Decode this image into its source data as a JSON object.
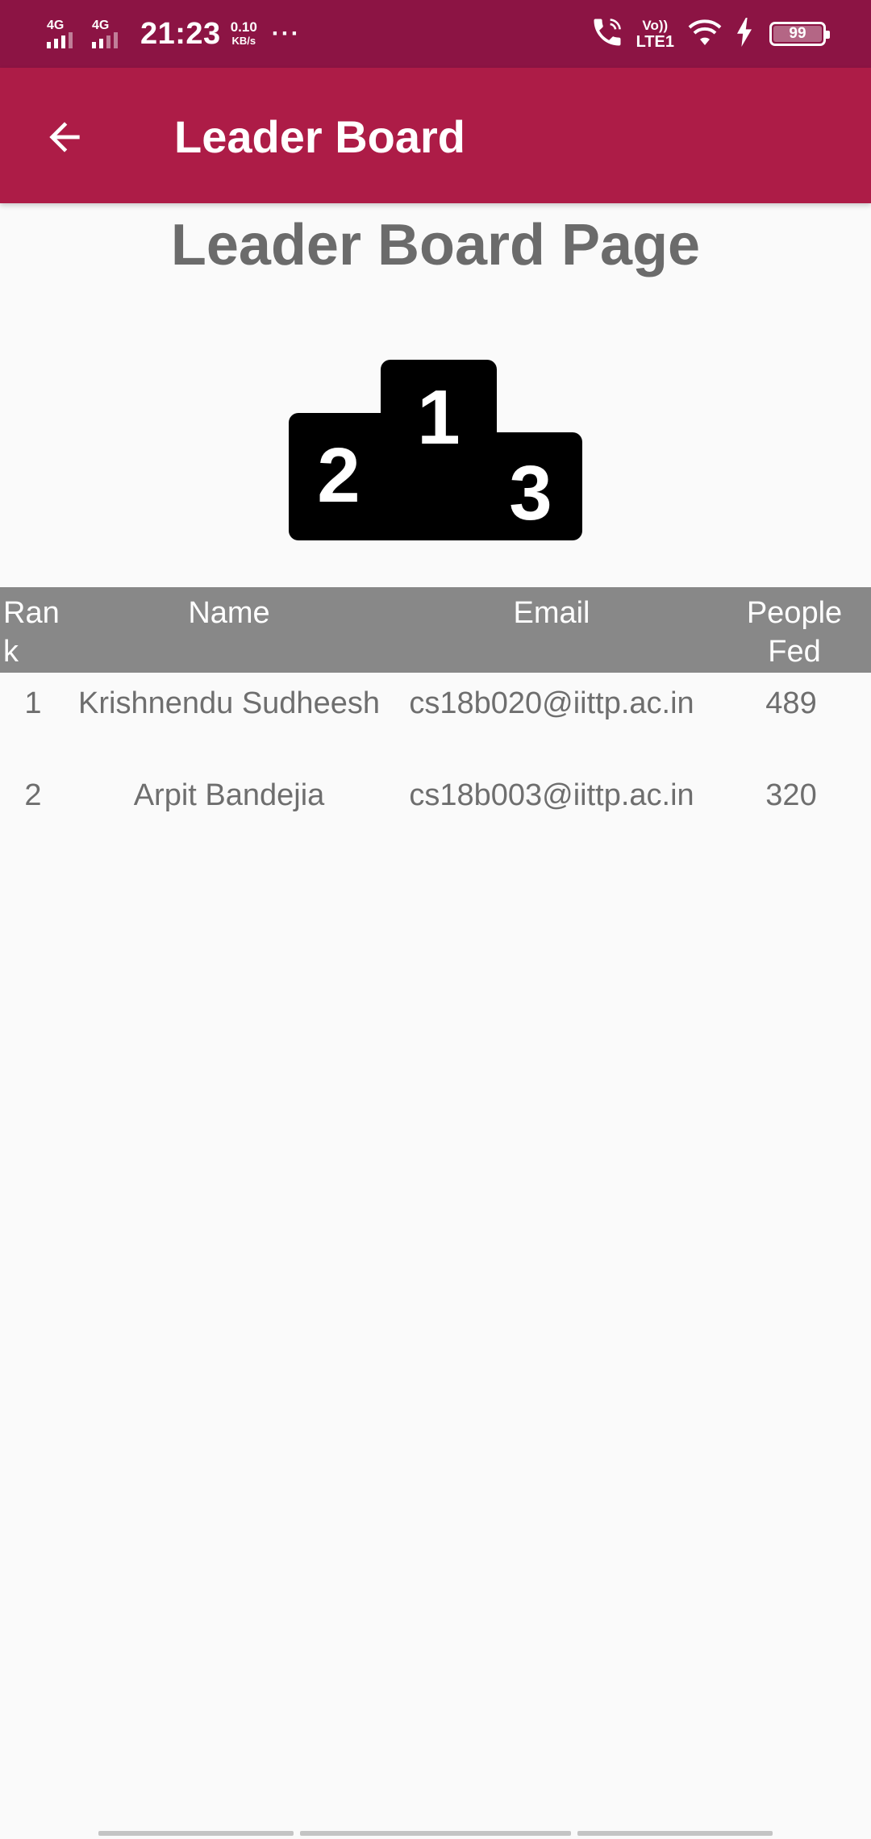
{
  "status_bar": {
    "network_1": "4G",
    "network_2": "4G",
    "time": "21:23",
    "speed_value": "0.10",
    "speed_unit": "KB/s",
    "more": "···",
    "volte_top": "Vo))",
    "volte_bottom": "LTE1",
    "battery_level": "99",
    "icons": [
      "signal-icon",
      "wifi-calling-icon",
      "wifi-icon",
      "charging-icon",
      "battery-icon"
    ]
  },
  "app_bar": {
    "title": "Leader Board",
    "back_icon": "arrow-back-icon",
    "background": "#ad1c47"
  },
  "page": {
    "title": "Leader Board Page",
    "podium_icon": "podium-icon",
    "podium_places": [
      "1",
      "2",
      "3"
    ]
  },
  "table": {
    "headers": [
      "Rank",
      "Name",
      "Email",
      "People Fed"
    ],
    "rows": [
      {
        "rank": "1",
        "name": "Krishnendu Sudheesh",
        "email": "cs18b020@iittp.ac.in",
        "people_fed": "489"
      },
      {
        "rank": "2",
        "name": "Arpit Bandejia",
        "email": "cs18b003@iittp.ac.in",
        "people_fed": "320"
      }
    ],
    "header_background": "#888888"
  },
  "colors": {
    "status_bar": "#8c1444",
    "app_bar": "#ad1c47",
    "page_background": "#fafafa",
    "title_text": "#6b6b6b"
  }
}
